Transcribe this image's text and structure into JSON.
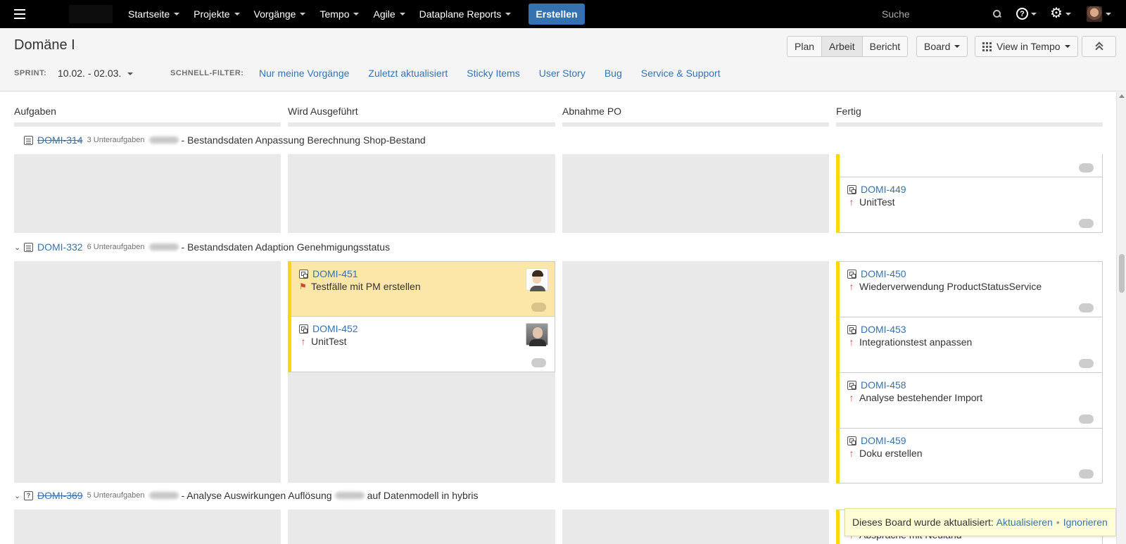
{
  "nav": {
    "items": [
      "Startseite",
      "Projekte",
      "Vorgänge",
      "Tempo",
      "Agile",
      "Dataplane Reports"
    ],
    "create_label": "Erstellen",
    "search_placeholder": "Suche",
    "help_glyph": "?"
  },
  "header": {
    "title": "Domäne I",
    "sprint_label": "SPRINT:",
    "sprint_value": "10.02. - 02.03.",
    "quickfilter_label": "SCHNELL-FILTER:",
    "quickfilters": [
      "Nur meine Vorgänge",
      "Zuletzt aktualisiert",
      "Sticky Items",
      "User Story",
      "Bug",
      "Service & Support"
    ],
    "modes": [
      "Plan",
      "Arbeit",
      "Bericht"
    ],
    "active_mode": "Arbeit",
    "board_label": "Board",
    "tempo_label": "View in Tempo"
  },
  "columns": [
    "Aufgaben",
    "Wird Ausgeführt",
    "Abnahme PO",
    "Fertig"
  ],
  "swimlanes": [
    {
      "key": "DOMI-314",
      "subtasks": "3 Unterauf­gaben",
      "summary": "- Bestandsdaten Anpassung Berechnung Shop-Bestand",
      "done": true,
      "cards": [
        {
          "key": "DOMI-449",
          "summary": "UnitTest",
          "column": "Fertig"
        }
      ]
    },
    {
      "key": "DOMI-332",
      "subtasks": "6 Unteraufgaben",
      "summary": "- Bestandsdaten Adaption Genehmigungsstatus",
      "done": false,
      "cards": [
        {
          "key": "DOMI-451",
          "summary": "Testfälle mit PM erstellen",
          "column": "Wird Ausgeführt",
          "flagged": true
        },
        {
          "key": "DOMI-452",
          "summary": "UnitTest",
          "column": "Wird Ausgeführt"
        },
        {
          "key": "DOMI-450",
          "summary": "Wiederverwendung ProductStatusService",
          "column": "Fertig"
        },
        {
          "key": "DOMI-453",
          "summary": "Integrationstest anpassen",
          "column": "Fertig"
        },
        {
          "key": "DOMI-458",
          "summary": "Analyse bestehender Import",
          "column": "Fertig"
        },
        {
          "key": "DOMI-459",
          "summary": "Doku erstellen",
          "column": "Fertig"
        }
      ]
    },
    {
      "key": "DOMI-369",
      "subtasks": "5 Unteraufgaben",
      "summary_before": "- Analyse Auswirkungen Auflösung",
      "summary_after": "auf Datenmodell in hybris",
      "done": true,
      "cards": [
        {
          "key": "",
          "summary": "Absprache mit Neuland",
          "column": "Fertig"
        }
      ]
    }
  ],
  "notification": {
    "text": "Dieses Board wurde aktualisiert:",
    "action": "Aktualisieren",
    "separator": "•",
    "dismiss": "Ignorieren"
  },
  "colors": {
    "accent": "#3572b0",
    "topbar": "#000000",
    "card_stripe": "#f5d90a",
    "flagged_card": "#fce6a8",
    "priority": "#d04437"
  },
  "icons": [
    "menu-icon",
    "search-icon",
    "help-icon",
    "gear-icon",
    "story-icon",
    "subtask-icon",
    "priority-major-icon",
    "flag-icon",
    "collapse-icon",
    "grid-icon"
  ]
}
